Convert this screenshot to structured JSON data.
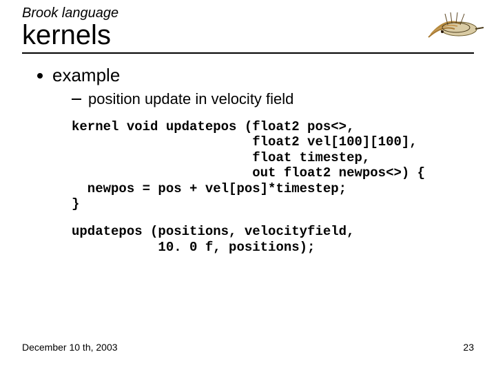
{
  "header": {
    "pretitle": "Brook language",
    "title": "kernels"
  },
  "bullets": {
    "level1": "example",
    "level2": "position update in velocity field"
  },
  "code": {
    "block1": "kernel void updatepos (float2 pos<>,\n                       float2 vel[100][100],\n                       float timestep,\n                       out float2 newpos<>) {\n  newpos = pos + vel[pos]*timestep;\n}",
    "block2": "updatepos (positions, velocityfield,\n           10. 0 f, positions);"
  },
  "footer": {
    "date": "December 10 th, 2003",
    "page": "23"
  },
  "icons": {
    "logo": "fishing-fly-icon"
  }
}
